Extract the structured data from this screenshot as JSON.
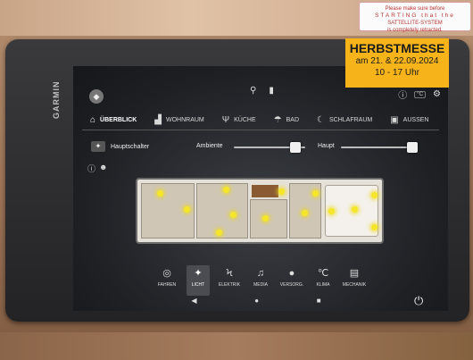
{
  "sticker": {
    "line1": "Please make sure before",
    "line2": "STARTING that the",
    "line3": "SATTELLITE-SYSTEM",
    "line4": "is completely retracted."
  },
  "device": {
    "brand": "GARMIN"
  },
  "rooms": [
    {
      "label": "ÜBERBLICK",
      "icon": "home-icon",
      "active": true
    },
    {
      "label": "WOHNRAUM",
      "icon": "sofa-icon",
      "active": false
    },
    {
      "label": "KÜCHE",
      "icon": "cutlery-icon",
      "active": false
    },
    {
      "label": "BAD",
      "icon": "shower-icon",
      "active": false
    },
    {
      "label": "SCHLAFRAUM",
      "icon": "moon-icon",
      "active": false
    },
    {
      "label": "AUßEN",
      "icon": "vehicle-icon",
      "active": false
    }
  ],
  "controls": {
    "main_switch": "Hauptschalter",
    "ambient": "Ambiente",
    "main": "Haupt",
    "ambient_level": 0.86,
    "main_level": 0.95
  },
  "nav": [
    {
      "label": "FAHREN",
      "icon": "steering-wheel-icon",
      "active": false
    },
    {
      "label": "LICHT",
      "icon": "light-bulb-icon",
      "active": true
    },
    {
      "label": "ELEKTRIK",
      "icon": "lightning-icon",
      "active": false
    },
    {
      "label": "MEDIA",
      "icon": "music-icon",
      "active": false
    },
    {
      "label": "VERSORG.",
      "icon": "water-drop-icon",
      "active": false
    },
    {
      "label": "KLIMA",
      "icon": "thermometer-icon",
      "active": false
    },
    {
      "label": "MECHANIK",
      "icon": "mechanic-icon",
      "active": false
    }
  ],
  "overlay": {
    "title": "HERBSTMESSE",
    "dates": "am 21. & 22.09.2024",
    "hours": "10 - 17 Uhr"
  },
  "colors": {
    "accent": "#f7b41a",
    "light_on": "#f6e62a"
  }
}
